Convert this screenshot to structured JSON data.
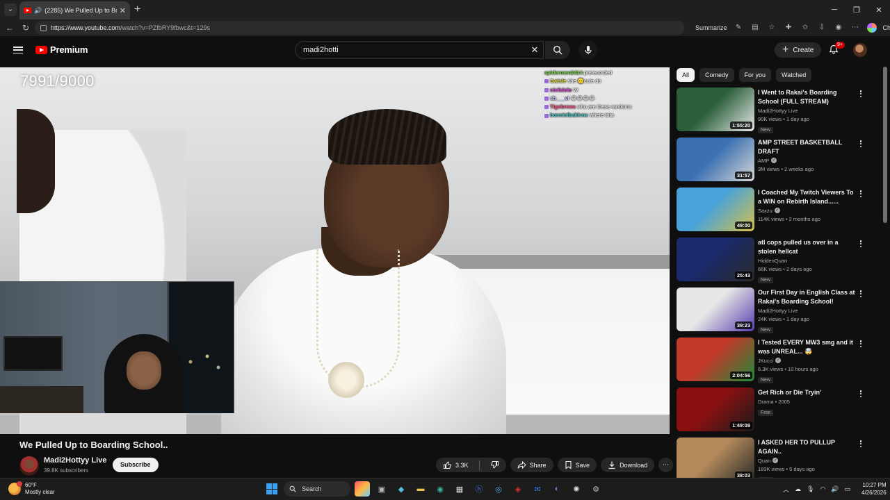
{
  "browser": {
    "tab": {
      "title": "(2285) We Pulled Up to Boardi..."
    },
    "url": {
      "domain": "https://www.youtube.com",
      "path": "/watch?v=PZfbRY9fbwc&t=129s"
    },
    "summarize_label": "Summarize"
  },
  "youtube": {
    "logo_text": "Premium",
    "search": {
      "value": "madi2hotti"
    },
    "create_label": "Create",
    "notifications_badge": "9+"
  },
  "overlay": {
    "counter": "7991/9000",
    "chat": [
      {
        "user": "spidermen2414",
        "message": "prerecorded"
      },
      {
        "user": "Swisle",
        "message": "she 🙂cute do"
      },
      {
        "user": "ninfalolo",
        "message": "W"
      },
      {
        "user": "sb___vl",
        "message": "😂😂😂😂"
      },
      {
        "user": "Tigebrews",
        "message": "who are these randoms"
      },
      {
        "user": "bonnielbaklvnx",
        "message": "where tota"
      }
    ]
  },
  "video": {
    "title": "We Pulled Up to Boarding School..",
    "channel": {
      "name": "Madi2Hottyy Live",
      "subscribers": "39.8K subscribers"
    },
    "subscribe_label": "Subscribe",
    "likes": "3.3K",
    "share_label": "Share",
    "save_label": "Save",
    "download_label": "Download"
  },
  "chips": [
    "All",
    "Comedy",
    "For you",
    "Watched"
  ],
  "recommendations": [
    {
      "title": "I Went to Rakai's Boarding School (FULL STREAM)",
      "channel": "Madi2Hottyy Live",
      "verified": false,
      "meta": "90K views • 1 day ago",
      "badge": "New",
      "duration": "1:55:20",
      "thumb_colors": [
        "#2a5f3a",
        "#e8e8e8"
      ]
    },
    {
      "title": "AMP STREET BASKETBALL DRAFT",
      "channel": "AMP",
      "verified": true,
      "meta": "3M views • 2 weeks ago",
      "badge": "",
      "duration": "31:57",
      "thumb_colors": [
        "#3a6fb0",
        "#d8d8d8"
      ]
    },
    {
      "title": "I Coached My Twitch Viewers To a WIN on Rebirth Island......",
      "channel": "Saxzu",
      "verified": true,
      "meta": "114K views • 2 months ago",
      "badge": "",
      "duration": "49:00",
      "thumb_colors": [
        "#4aa3d8",
        "#d6c04a"
      ]
    },
    {
      "title": "atl cops pulled us over in a stolen hellcat",
      "channel": "HiddenQuan",
      "verified": false,
      "meta": "66K views • 2 days ago",
      "badge": "New",
      "duration": "25:43",
      "thumb_colors": [
        "#1a2a6a",
        "#2b2b2b"
      ]
    },
    {
      "title": "Our First Day in English Class at Rakai's Boarding School!",
      "channel": "Madi2Hottyy Live",
      "verified": false,
      "meta": "24K views • 1 day ago",
      "badge": "New",
      "duration": "39:23",
      "thumb_colors": [
        "#e6e6e6",
        "#5a3fb0"
      ]
    },
    {
      "title": "I Tested EVERY MW3 smg and it was UNREAL... 🤯",
      "channel": "JKucci",
      "verified": true,
      "meta": "6.3K views • 10 hours ago",
      "badge": "New",
      "duration": "2:04:56",
      "thumb_colors": [
        "#c23a2a",
        "#1e8a3a"
      ]
    },
    {
      "title": "Get Rich or Die Tryin'",
      "channel": "Drama • 2005",
      "verified": false,
      "meta": "",
      "badge": "Free",
      "duration": "1:49:08",
      "thumb_colors": [
        "#8a1010",
        "#1a1a1a"
      ]
    },
    {
      "title": "I ASKED HER TO PULLUP AGAIN..",
      "channel": "Quan",
      "verified": true,
      "meta": "183K views • 5 days ago",
      "badge": "New",
      "duration": "38:03",
      "thumb_colors": [
        "#b58a5a",
        "#2a2a2a"
      ]
    }
  ],
  "taskbar": {
    "weather": {
      "temp": "60°F",
      "condition": "Mostly clear"
    },
    "search_label": "Search",
    "time": "10:27 PM",
    "date": "4/26/2026"
  }
}
